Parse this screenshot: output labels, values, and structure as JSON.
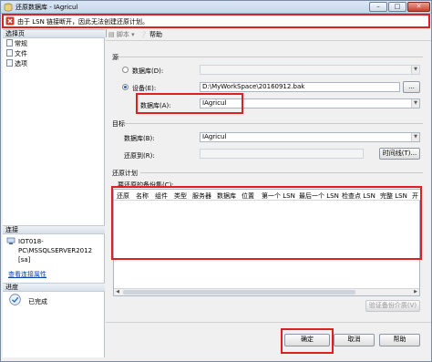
{
  "window": {
    "title": "还原数据库 - IAgricul",
    "min": "–",
    "max": "□",
    "close": "✕"
  },
  "error": {
    "message": "由于 LSN 链接断开，因此无法创建还原计划。"
  },
  "left": {
    "pages_header": "选择页",
    "pages": [
      "常规",
      "文件",
      "选项"
    ],
    "conn_header": "连接",
    "connection": "IOT018-PC\\MSSQLSERVER2012 [sa]",
    "conn_link": "查看连接属性",
    "progress_header": "进度",
    "progress_status": "已完成"
  },
  "toolbar": {
    "script": "脚本",
    "script_arrow": "▾",
    "help": "帮助"
  },
  "source": {
    "section": "源",
    "database_label": "数据库(D):",
    "device_label": "设备(E):",
    "device_value": "D:\\MyWorkSpace\\20160912.bak",
    "browse": "...",
    "db_label": "数据库(A):",
    "db_value": "IAgricul"
  },
  "target": {
    "section": "目标",
    "database_label": "数据库(B):",
    "database_value": "IAgricul",
    "restore_to_label": "还原到(R):",
    "timeline_button": "时间线(T)..."
  },
  "plan": {
    "section": "还原计划",
    "sets_label": "要还原的备份集(C):",
    "columns": [
      "还原",
      "名称",
      "组件",
      "类型",
      "服务器",
      "数据库",
      "位置",
      "第一个 LSN",
      "最后一个 LSN",
      "检查点 LSN",
      "完整 LSN",
      "开"
    ],
    "verify_button": "验证备份介质(V)",
    "scroll_left": "◀",
    "scroll_right": "▶"
  },
  "buttons": {
    "ok": "确定",
    "cancel": "取消",
    "help": "帮助"
  }
}
